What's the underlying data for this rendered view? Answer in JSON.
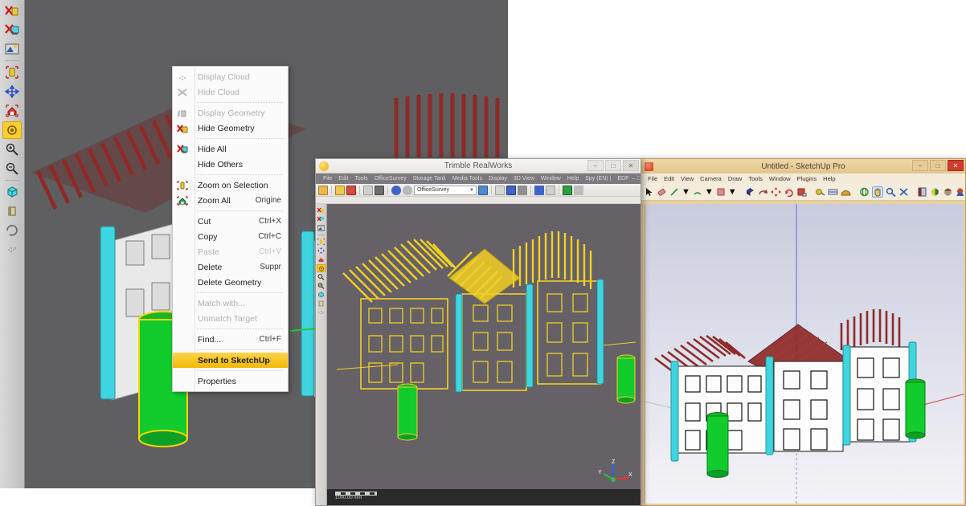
{
  "context_menu": {
    "name": "RealWorks object context menu",
    "items": [
      {
        "label": "Display Cloud",
        "accel": "",
        "state": "disabled",
        "icon": "cloud-display-icon",
        "sep_after": false
      },
      {
        "label": "Hide Cloud",
        "accel": "",
        "state": "disabled",
        "icon": "cloud-hide-icon",
        "sep_after": true
      },
      {
        "label": "Display Geometry",
        "accel": "",
        "state": "disabled",
        "icon": "geometry-display-icon",
        "sep_after": false
      },
      {
        "label": "Hide Geometry",
        "accel": "",
        "state": "enabled",
        "icon": "geometry-hide-icon",
        "sep_after": true
      },
      {
        "label": "Hide All",
        "accel": "",
        "state": "enabled",
        "icon": "hide-all-icon",
        "sep_after": false
      },
      {
        "label": "Hide Others",
        "accel": "",
        "state": "enabled",
        "icon": "",
        "sep_after": true
      },
      {
        "label": "Zoom on Selection",
        "accel": "",
        "state": "enabled",
        "icon": "zoom-selection-icon",
        "sep_after": false
      },
      {
        "label": "Zoom All",
        "accel": "Origine",
        "state": "enabled",
        "icon": "zoom-all-icon",
        "sep_after": true
      },
      {
        "label": "Cut",
        "accel": "Ctrl+X",
        "state": "enabled",
        "icon": "",
        "sep_after": false
      },
      {
        "label": "Copy",
        "accel": "Ctrl+C",
        "state": "enabled",
        "icon": "",
        "sep_after": false
      },
      {
        "label": "Paste",
        "accel": "Ctrl+V",
        "state": "disabled",
        "icon": "",
        "sep_after": false
      },
      {
        "label": "Delete",
        "accel": "Suppr",
        "state": "enabled",
        "icon": "",
        "sep_after": false
      },
      {
        "label": "Delete Geometry",
        "accel": "",
        "state": "enabled",
        "icon": "",
        "sep_after": true
      },
      {
        "label": "Match with...",
        "accel": "",
        "state": "disabled",
        "icon": "",
        "sep_after": false
      },
      {
        "label": "Unmatch Target",
        "accel": "",
        "state": "disabled",
        "icon": "",
        "sep_after": true
      },
      {
        "label": "Find...",
        "accel": "Ctrl+F",
        "state": "enabled",
        "icon": "",
        "sep_after": true
      },
      {
        "label": "Send to SketchUp",
        "accel": "",
        "state": "highlighted",
        "icon": "",
        "sep_after": true
      },
      {
        "label": "Properties",
        "accel": "",
        "state": "enabled",
        "icon": "",
        "sep_after": false
      }
    ]
  },
  "background_window": {
    "toolbar_icons": [
      "hide-geometry-icon",
      "hide-all-icon",
      "render-mode-icon",
      "separator",
      "limit-box-icon",
      "pan-icon",
      "zoom-all-icon",
      "zoom-extents-icon",
      "zoom-in-icon",
      "zoom-out-icon",
      "separator",
      "box-view-icon",
      "section-icon",
      "rotate-icon",
      "cloud-icon"
    ],
    "viewport_bg": "#5f5f61"
  },
  "realworks_window": {
    "title": "Trimble RealWorks",
    "app_icon": "trimble-icon",
    "window_buttons": [
      "minimize",
      "maximize",
      "close"
    ],
    "menus": [
      "File",
      "Edit",
      "Tools",
      "OfficeSurvey",
      "Storage Tank",
      "Media Tools",
      "Display",
      "3D View",
      "Window",
      "Help",
      "Spy (EN) |",
      "EDF"
    ],
    "toolbar": {
      "project_combo_value": "OfficeSurvey",
      "icons": [
        "open-icon",
        "save-icon",
        "new-icon",
        "brush-icon",
        "list-icon",
        "print-icon",
        "undo-icon",
        "redo-icon"
      ]
    },
    "viewport_bg": "#656167",
    "scale_bar_label": "1000.00 mm",
    "axis": {
      "x": "X",
      "y": "Y",
      "z": "Z",
      "x_color": "#e03a2f",
      "y_color": "#2fbd4a",
      "z_color": "#3a63d8"
    },
    "model_color": "#f2d024"
  },
  "sketchup_window": {
    "title": "Untitled - SketchUp Pro",
    "app_icon": "sketchup-icon",
    "window_buttons": [
      "minimize",
      "maximize",
      "close"
    ],
    "menus": [
      "File",
      "Edit",
      "View",
      "Camera",
      "Draw",
      "Tools",
      "Window",
      "Plugins",
      "Help"
    ],
    "toolbar_icons": [
      "select-arrow-icon",
      "eraser-icon",
      "line-icon",
      "line-dropdown-icon",
      "arc-icon",
      "arc-dropdown-icon",
      "rectangle-icon",
      "rectangle-dropdown-icon",
      "pushpull-icon",
      "followme-icon",
      "move-icon",
      "rotate-icon",
      "scale-icon",
      "tape-measure-icon",
      "dimension-icon",
      "paint-bucket-icon",
      "orbit-icon",
      "pan-icon",
      "zoom-icon",
      "zoom-extents-icon",
      "section-plane-icon",
      "shadows-icon",
      "fog-icon",
      "position-camera-icon"
    ],
    "selected_tool": "pan-icon",
    "viewport_bg_top": "#c9ccdd",
    "viewport_bg_bottom": "#f4f3f7",
    "axis_colors": {
      "blue": "#8a92d8",
      "red": "#d05a5a",
      "green": "#6fb36f"
    }
  },
  "colors": {
    "roof_red": "#8e2b28",
    "model_yellow": "#f2d024",
    "cylinder_green": "#12cc2e",
    "cyan_column": "#3fd5e0",
    "highlight": "#f2b705"
  }
}
